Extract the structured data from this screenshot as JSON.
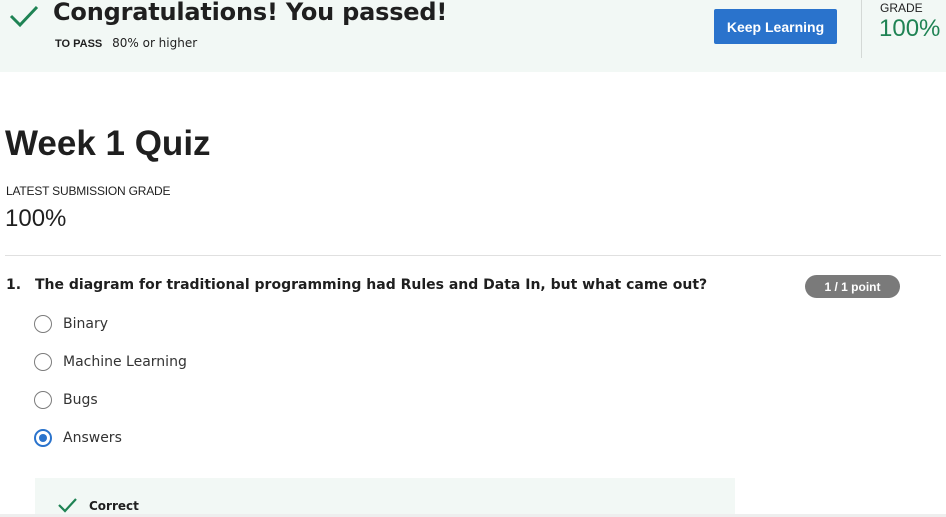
{
  "banner": {
    "title": "Congratulations! You passed!",
    "to_pass_label": "TO PASS",
    "to_pass_value": "80% or higher",
    "keep_learning": "Keep Learning",
    "grade_label": "GRADE",
    "grade_value": "100%"
  },
  "quiz": {
    "title": "Week 1 Quiz",
    "latest_label": "LATEST SUBMISSION GRADE",
    "latest_value": "100%"
  },
  "question": {
    "number": "1.",
    "text": "The diagram for traditional programming had Rules and Data In, but what came out?",
    "points": "1 / 1 point",
    "options": [
      {
        "label": "Binary",
        "checked": false
      },
      {
        "label": "Machine Learning",
        "checked": false
      },
      {
        "label": "Bugs",
        "checked": false
      },
      {
        "label": "Answers",
        "checked": true
      }
    ],
    "feedback": "Correct"
  },
  "colors": {
    "accent": "#2a73cc",
    "success": "#1f8354",
    "banner_bg": "#f2f8f5"
  }
}
